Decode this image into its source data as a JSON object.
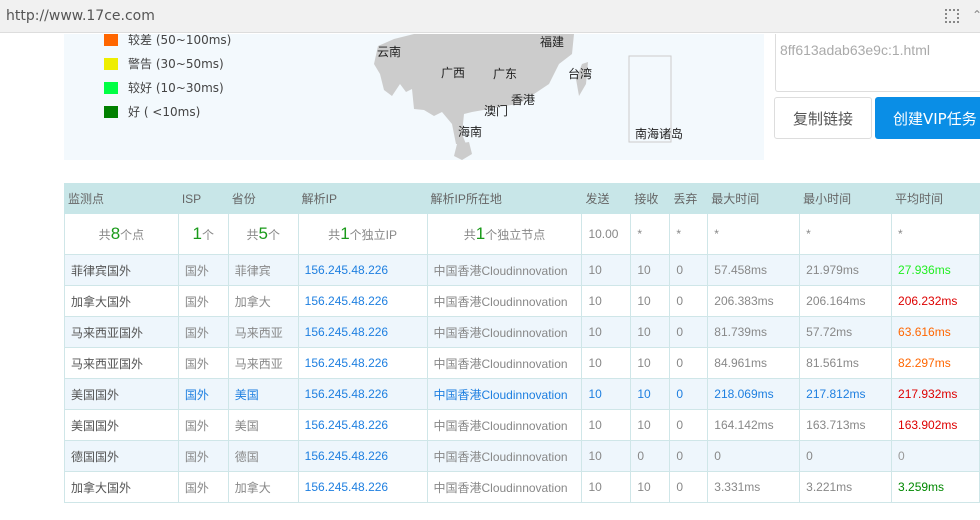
{
  "browser": {
    "url": "http://www.17ce.com",
    "qr_icon": "qr-code-icon"
  },
  "legend": [
    {
      "label": "较差 (50~100ms)",
      "color": "#ff6600"
    },
    {
      "label": "警告 (30~50ms)",
      "color": "#eeee00"
    },
    {
      "label": "较好 (10~30ms)",
      "color": "#00ff44"
    },
    {
      "label": "好 ( <10ms)",
      "color": "#008000"
    }
  ],
  "map": {
    "provinces": [
      "云南",
      "福建",
      "广西",
      "广东",
      "台湾",
      "香港",
      "澳门",
      "海南"
    ],
    "inset_label": "南海诸岛"
  },
  "share": {
    "link_text": "8ff613adab63e9c:1.html",
    "copy_label": "复制链接",
    "vip_label": "创建VIP任务"
  },
  "table": {
    "headers": [
      "监测点",
      "ISP",
      "省份",
      "解析IP",
      "解析IP所在地",
      "发送",
      "接收",
      "丢弃",
      "最大时间",
      "最小时间",
      "平均时间"
    ],
    "summary": {
      "points_pre": "共",
      "points": "8",
      "points_post": "个点",
      "isp": "1",
      "isp_post": "个",
      "prov_pre": "共",
      "prov": "5",
      "prov_post": "个",
      "ip_pre": "共",
      "ip": "1",
      "ip_post": "个独立IP",
      "node_pre": "共",
      "node": "1",
      "node_post": "个独立节点",
      "send": "10.00",
      "recv": "*",
      "lost": "*",
      "max": "*",
      "min": "*",
      "avg": "*"
    },
    "rows": [
      {
        "name": "菲律宾国外",
        "isp": "国外",
        "prov": "菲律宾",
        "ip": "156.245.48.226",
        "loc": "中国香港Cloudinnovation",
        "send": "10",
        "recv": "10",
        "lost": "0",
        "max": "57.458ms",
        "min": "21.979ms",
        "avg": "27.936ms",
        "avg_color": "#22ee22"
      },
      {
        "name": "加拿大国外",
        "isp": "国外",
        "prov": "加拿大",
        "ip": "156.245.48.226",
        "loc": "中国香港Cloudinnovation",
        "send": "10",
        "recv": "10",
        "lost": "0",
        "max": "206.383ms",
        "min": "206.164ms",
        "avg": "206.232ms",
        "avg_color": "#dd0000"
      },
      {
        "name": "马来西亚国外",
        "isp": "国外",
        "prov": "马来西亚",
        "ip": "156.245.48.226",
        "loc": "中国香港Cloudinnovation",
        "send": "10",
        "recv": "10",
        "lost": "0",
        "max": "81.739ms",
        "min": "57.72ms",
        "avg": "63.616ms",
        "avg_color": "#ff6600"
      },
      {
        "name": "马来西亚国外",
        "isp": "国外",
        "prov": "马来西亚",
        "ip": "156.245.48.226",
        "loc": "中国香港Cloudinnovation",
        "send": "10",
        "recv": "10",
        "lost": "0",
        "max": "84.961ms",
        "min": "81.561ms",
        "avg": "82.297ms",
        "avg_color": "#ff6600"
      },
      {
        "name": "美国国外",
        "isp": "国外",
        "prov": "美国",
        "ip": "156.245.48.226",
        "loc": "中国香港Cloudinnovation",
        "send": "10",
        "recv": "10",
        "lost": "0",
        "max": "218.069ms",
        "min": "217.812ms",
        "avg": "217.932ms",
        "avg_color": "#dd0000",
        "highlight": true
      },
      {
        "name": "美国国外",
        "isp": "国外",
        "prov": "美国",
        "ip": "156.245.48.226",
        "loc": "中国香港Cloudinnovation",
        "send": "10",
        "recv": "10",
        "lost": "0",
        "max": "164.142ms",
        "min": "163.713ms",
        "avg": "163.902ms",
        "avg_color": "#dd0000"
      },
      {
        "name": "德国国外",
        "isp": "国外",
        "prov": "德国",
        "ip": "156.245.48.226",
        "loc": "中国香港Cloudinnovation",
        "send": "10",
        "recv": "0",
        "lost": "0",
        "max": "0",
        "min": "0",
        "avg": "0",
        "avg_color": "#999999"
      },
      {
        "name": "加拿大国外",
        "isp": "国外",
        "prov": "加拿大",
        "ip": "156.245.48.226",
        "loc": "中国香港Cloudinnovation",
        "send": "10",
        "recv": "10",
        "lost": "0",
        "max": "3.331ms",
        "min": "3.221ms",
        "avg": "3.259ms",
        "avg_color": "#008800"
      }
    ]
  }
}
